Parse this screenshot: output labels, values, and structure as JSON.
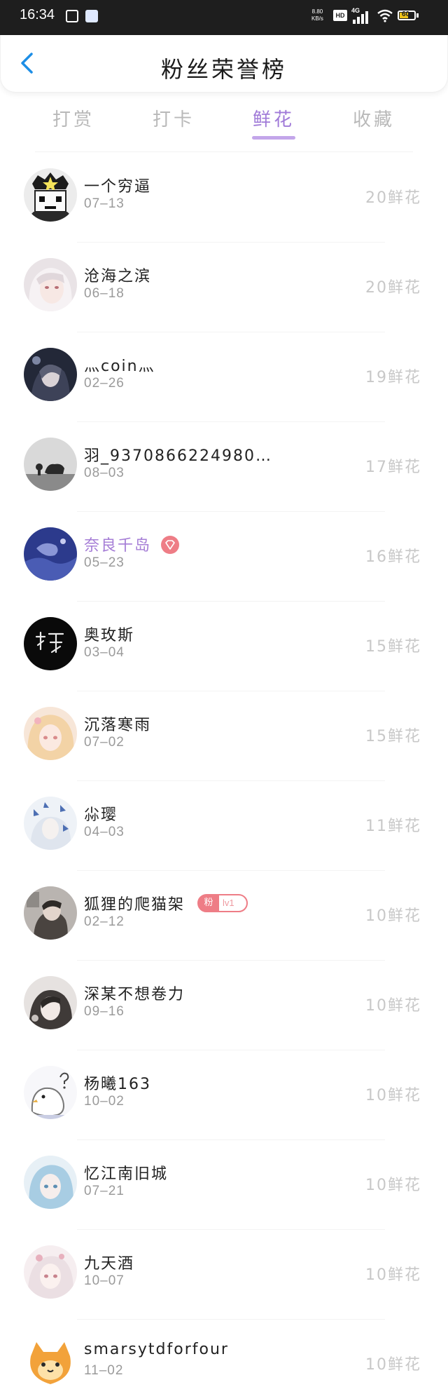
{
  "status_bar": {
    "time": "16:34",
    "speed_value": "8.80",
    "speed_unit": "KB/s",
    "hd": "HD",
    "network": "4G",
    "battery": "60"
  },
  "header": {
    "title": "粉丝荣誉榜"
  },
  "tabs": [
    {
      "label": "打赏",
      "active": false
    },
    {
      "label": "打卡",
      "active": false
    },
    {
      "label": "鲜花",
      "active": true
    },
    {
      "label": "收藏",
      "active": false
    }
  ],
  "rows": [
    {
      "name": "一个穷逼",
      "date": "07–13",
      "amount": "20鲜花"
    },
    {
      "name": "沧海之滨",
      "date": "06–18",
      "amount": "20鲜花"
    },
    {
      "name": "灬coin灬",
      "date": "02–26",
      "amount": "19鲜花"
    },
    {
      "name": "羽_9370866224980…",
      "date": "08–03",
      "amount": "17鲜花"
    },
    {
      "name": "奈良千岛",
      "date": "05–23",
      "amount": "16鲜花"
    },
    {
      "name": "奥玫斯",
      "date": "03–04",
      "amount": "15鲜花"
    },
    {
      "name": "沉落寒雨",
      "date": "07–02",
      "amount": "15鲜花"
    },
    {
      "name": "尛璎",
      "date": "04–03",
      "amount": "11鲜花"
    },
    {
      "name": "狐狸的爬猫架",
      "date": "02–12",
      "amount": "10鲜花"
    },
    {
      "name": "深某不想卷力",
      "date": "09–16",
      "amount": "10鲜花"
    },
    {
      "name": "杨曦163",
      "date": "10–02",
      "amount": "10鲜花"
    },
    {
      "name": "忆江南旧城",
      "date": "07–21",
      "amount": "10鲜花"
    },
    {
      "name": "九天酒",
      "date": "10–07",
      "amount": "10鲜花"
    },
    {
      "name": "smarsytdforfour",
      "date": "11–02",
      "amount": "10鲜花"
    }
  ],
  "badges": {
    "fan_label": "粉",
    "fan_level": "lv1"
  },
  "colors": {
    "accent": "#a07ad8",
    "tab_underline": "#c3a6ea",
    "badge": "#ee7d86",
    "amount": "#c8c8c8",
    "date": "#9a9a9a"
  }
}
